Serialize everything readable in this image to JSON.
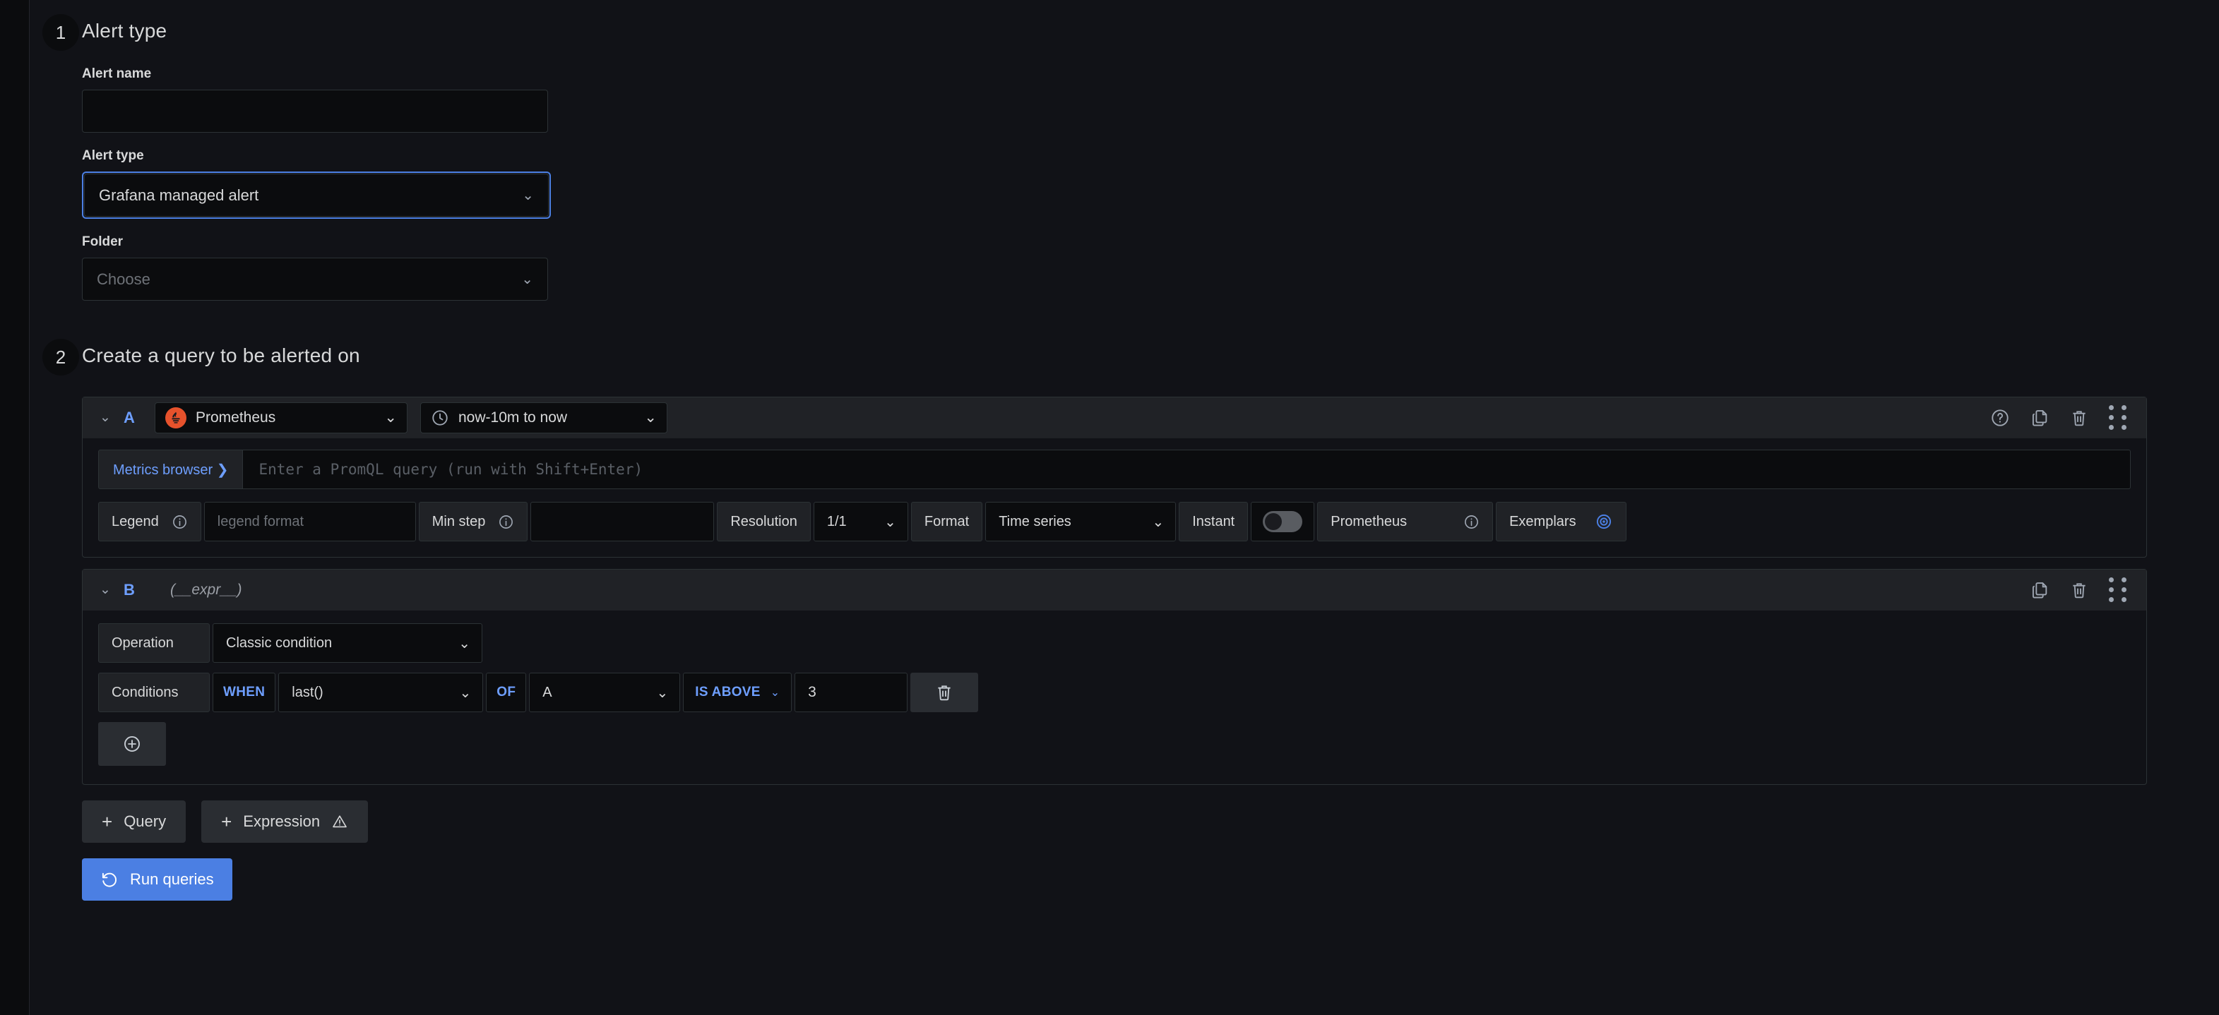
{
  "steps": {
    "one": {
      "number": "1",
      "title": "Alert type"
    },
    "two": {
      "number": "2",
      "title": "Create a query to be alerted on"
    }
  },
  "alert_type_section": {
    "alert_name": {
      "label": "Alert name",
      "value": "",
      "placeholder": ""
    },
    "alert_type": {
      "label": "Alert type",
      "value": "Grafana managed alert",
      "caret": "⌄"
    },
    "folder": {
      "label": "Folder",
      "placeholder": "Choose",
      "caret": "⌄"
    }
  },
  "query_a": {
    "ref_id": "A",
    "collapse_caret": "⌄",
    "datasource": {
      "name": "Prometheus",
      "caret": "⌄",
      "icon": "prometheus-icon"
    },
    "time_range": {
      "value": "now-10m to now",
      "caret": "⌄",
      "icon": "clock-icon"
    },
    "actions": [
      "help-icon",
      "copy-icon",
      "trash-icon",
      "drag-handle-icon"
    ],
    "metrics_browser": "Metrics browser ❯",
    "promql_placeholder": "Enter a PromQL query (run with Shift+Enter)",
    "options": {
      "legend_label": "Legend",
      "legend_placeholder": "legend format",
      "legend_value": "",
      "min_step_label": "Min step",
      "min_step_value": "",
      "resolution_label": "Resolution",
      "resolution_value": "1/1",
      "format_label": "Format",
      "format_value": "Time series",
      "instant_label": "Instant",
      "instant_on": false,
      "exemplars_source_label": "Prometheus",
      "exemplars_label": "Exemplars",
      "caret": "⌄"
    }
  },
  "query_b": {
    "ref_id": "B",
    "collapse_caret": "⌄",
    "datasource_label": "(__expr__)",
    "actions": [
      "copy-icon",
      "trash-icon",
      "drag-handle-icon"
    ],
    "operation_label": "Operation",
    "operation_value": "Classic condition",
    "conditions_label": "Conditions",
    "when_keyword": "WHEN",
    "reducer_value": "last()",
    "of_keyword": "OF",
    "query_ref_value": "A",
    "evaluator_value": "IS ABOVE",
    "threshold_value": "3",
    "caret": "⌄",
    "add_condition_icon": "plus-circle-icon",
    "delete_condition_icon": "trash-icon"
  },
  "footer": {
    "add_query_label": "Query",
    "add_expression_label": "Expression",
    "expression_warning_icon": "warning-triangle-icon",
    "run_queries_label": "Run queries",
    "run_icon": "history-refresh-icon",
    "plus": "+"
  },
  "colors": {
    "page_bg": "#111217",
    "panel_header": "#202226",
    "input_bg": "#0b0c0e",
    "border": "#2c3235",
    "accent_blue": "#6e9fff",
    "primary_button": "#4b7fe3",
    "focus_ring": "#4b7fe3",
    "prometheus_orange": "#e6522c",
    "text": "#d8d9da",
    "text_muted": "#6e7278"
  }
}
